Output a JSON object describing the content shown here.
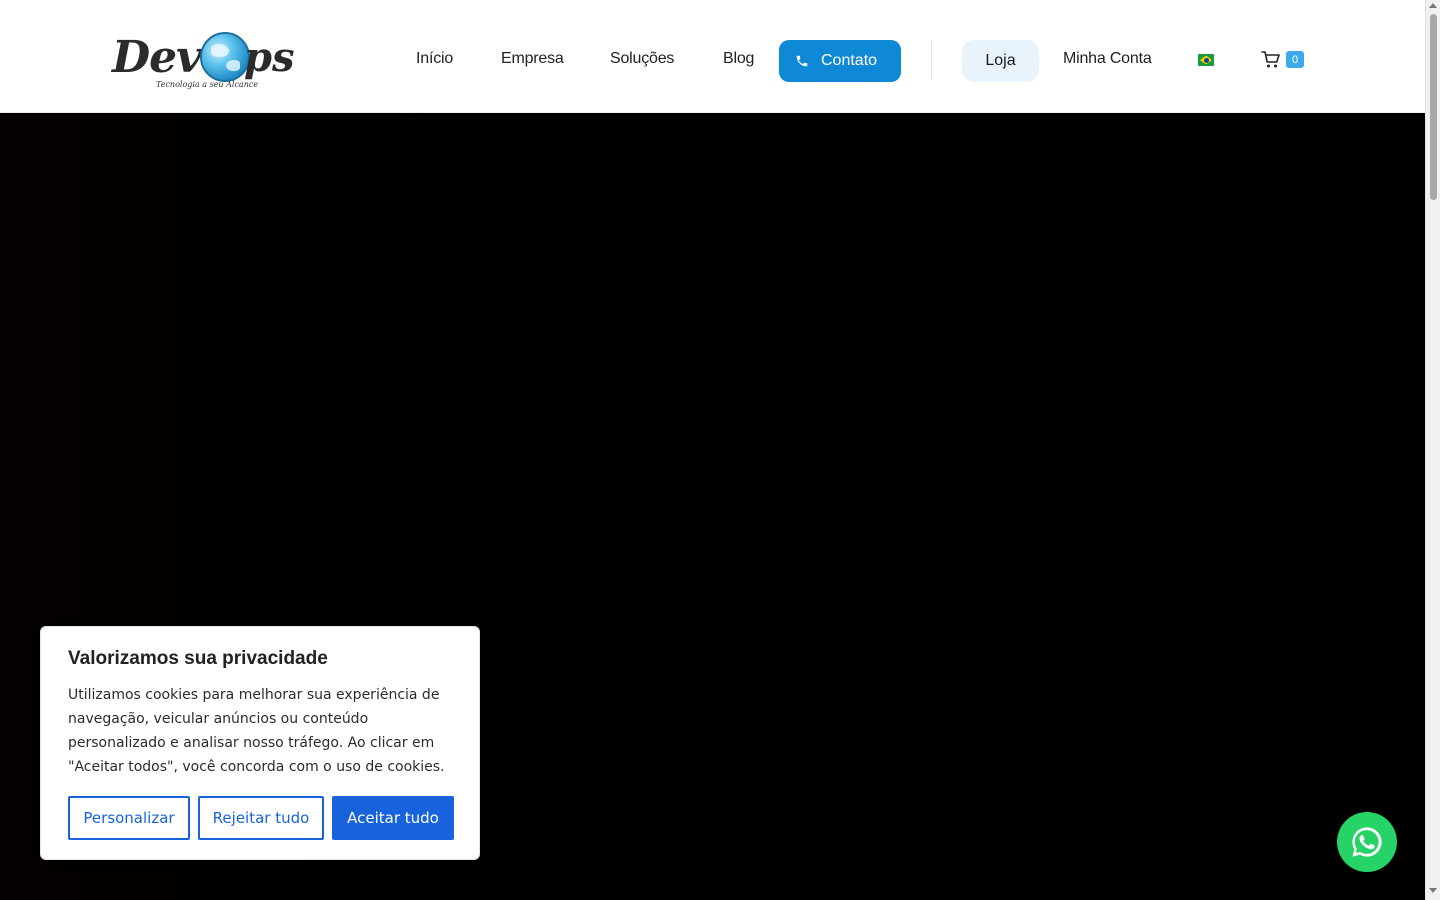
{
  "header": {
    "nav": {
      "inicio": "Início",
      "empresa": "Empresa",
      "solucoes": "Soluções",
      "blog": "Blog",
      "contato": "Contato",
      "loja": "Loja",
      "minha_conta": "Minha Conta"
    },
    "cart_count": "0",
    "icons": [
      "phone-icon",
      "brazil-flag-icon",
      "cart-icon"
    ]
  },
  "logo": {
    "text_left": "Dev",
    "text_right": "ps",
    "tagline": "Tecnologia a seu Alcance"
  },
  "cookie_banner": {
    "title": "Valorizamos sua privacidade",
    "body": "Utilizamos cookies para melhorar sua experiência de navegação, veicular anúncios ou conteúdo personalizado e analisar nosso tráfego. Ao clicar em \"Aceitar todos\", você concorda com o uso de cookies.",
    "customize": "Personalizar",
    "reject": "Rejeitar tudo",
    "accept": "Aceitar tudo"
  },
  "colors": {
    "primary": "#0f89d6",
    "cookie_blue": "#1863dc",
    "whatsapp": "#25d366"
  }
}
